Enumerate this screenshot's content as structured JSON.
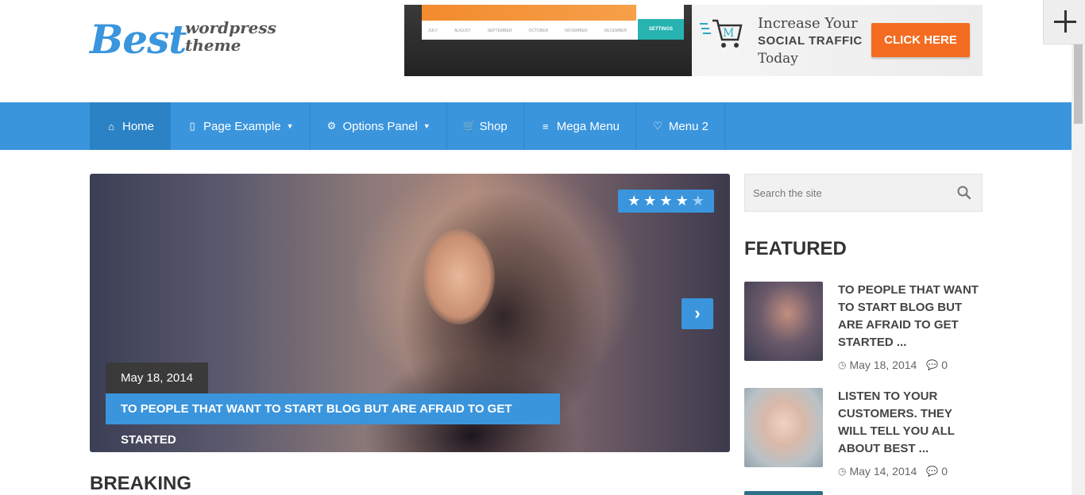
{
  "logo": {
    "big": "Best",
    "small_line1": "wordpress",
    "small_line2": "theme"
  },
  "banner": {
    "screen_ticks": [
      "JULY",
      "AUGUST",
      "SEPTEMBER",
      "OCTOBER",
      "NOVEMBER",
      "DECEMBER"
    ],
    "screen_label": "SETTINGS",
    "cart_letter": "M",
    "line1": "Increase Your",
    "line2": "SOCIAL TRAFFIC",
    "line3": "Today",
    "button": "CLICK HERE",
    "button_color": "#f36c21"
  },
  "nav": {
    "items": [
      {
        "label": "Home",
        "icon": "home-icon",
        "glyph": "⌂",
        "caret": false
      },
      {
        "label": "Page Example",
        "icon": "tablet-icon",
        "glyph": "▯",
        "caret": true
      },
      {
        "label": "Options Panel",
        "icon": "cogs-icon",
        "glyph": "⚙",
        "caret": true
      },
      {
        "label": "Shop",
        "icon": "cart-icon",
        "glyph": "🛒",
        "caret": false
      },
      {
        "label": "Mega Menu",
        "icon": "bars-icon",
        "glyph": "≡",
        "caret": false
      },
      {
        "label": "Menu 2",
        "icon": "heart-icon",
        "glyph": "♡",
        "caret": false
      }
    ],
    "color": "#3a95dd"
  },
  "slider": {
    "rating": 4,
    "rating_max": 5,
    "date": "May 18, 2014",
    "title": "TO PEOPLE THAT WANT TO START BLOG BUT ARE AFRAID TO GET STARTED",
    "next_glyph": "›"
  },
  "breaking": "BREAKING",
  "search": {
    "placeholder": "Search the site"
  },
  "featured": {
    "heading": "FEATURED",
    "posts": [
      {
        "title": "TO PEOPLE THAT WANT TO START BLOG BUT ARE AFRAID TO GET STARTED ...",
        "date": "May 18, 2014",
        "comments": "0"
      },
      {
        "title": "LISTEN TO YOUR CUSTOMERS. THEY WILL TELL YOU ALL ABOUT BEST ...",
        "date": "May 14, 2014",
        "comments": "0"
      }
    ]
  }
}
